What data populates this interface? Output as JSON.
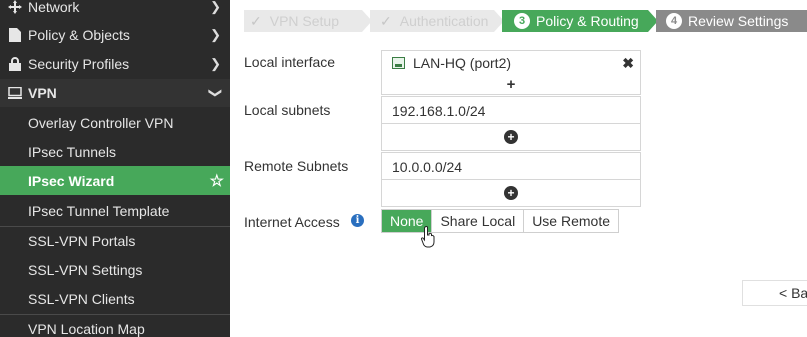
{
  "sidebar": {
    "top_items": [
      {
        "label": "Network",
        "icon": "network-icon"
      },
      {
        "label": "Policy & Objects",
        "icon": "policy-icon"
      },
      {
        "label": "Security Profiles",
        "icon": "lock-icon"
      },
      {
        "label": "VPN",
        "icon": "monitor-icon"
      }
    ],
    "vpn_items": [
      {
        "label": "Overlay Controller VPN"
      },
      {
        "label": "IPsec Tunnels"
      },
      {
        "label": "IPsec Wizard"
      },
      {
        "label": "IPsec Tunnel Template"
      },
      {
        "label": "SSL-VPN Portals"
      },
      {
        "label": "SSL-VPN Settings"
      },
      {
        "label": "SSL-VPN Clients"
      },
      {
        "label": "VPN Location Map"
      }
    ],
    "active_item": "IPsec Wizard"
  },
  "wizard": {
    "steps": [
      {
        "label": "VPN Setup",
        "state": "done"
      },
      {
        "label": "Authentication",
        "state": "done"
      },
      {
        "number": "3",
        "label": "Policy & Routing",
        "state": "current"
      },
      {
        "number": "4",
        "label": "Review Settings",
        "state": "todo"
      }
    ]
  },
  "form": {
    "local_interface_label": "Local interface",
    "local_interface_value": "LAN-HQ (port2)",
    "local_subnets_label": "Local subnets",
    "local_subnets_value": "192.168.1.0/24",
    "remote_subnets_label": "Remote Subnets",
    "remote_subnets_value": "10.0.0.0/24",
    "internet_access_label": "Internet Access",
    "internet_access_options": [
      "None",
      "Share Local",
      "Use Remote"
    ],
    "internet_access_selected": "None"
  },
  "footer": {
    "back_label": "< Ba"
  },
  "colors": {
    "accent": "#47a85a",
    "sidebar_bg": "#2b2b2b",
    "todo_step": "#8a8a8a"
  }
}
